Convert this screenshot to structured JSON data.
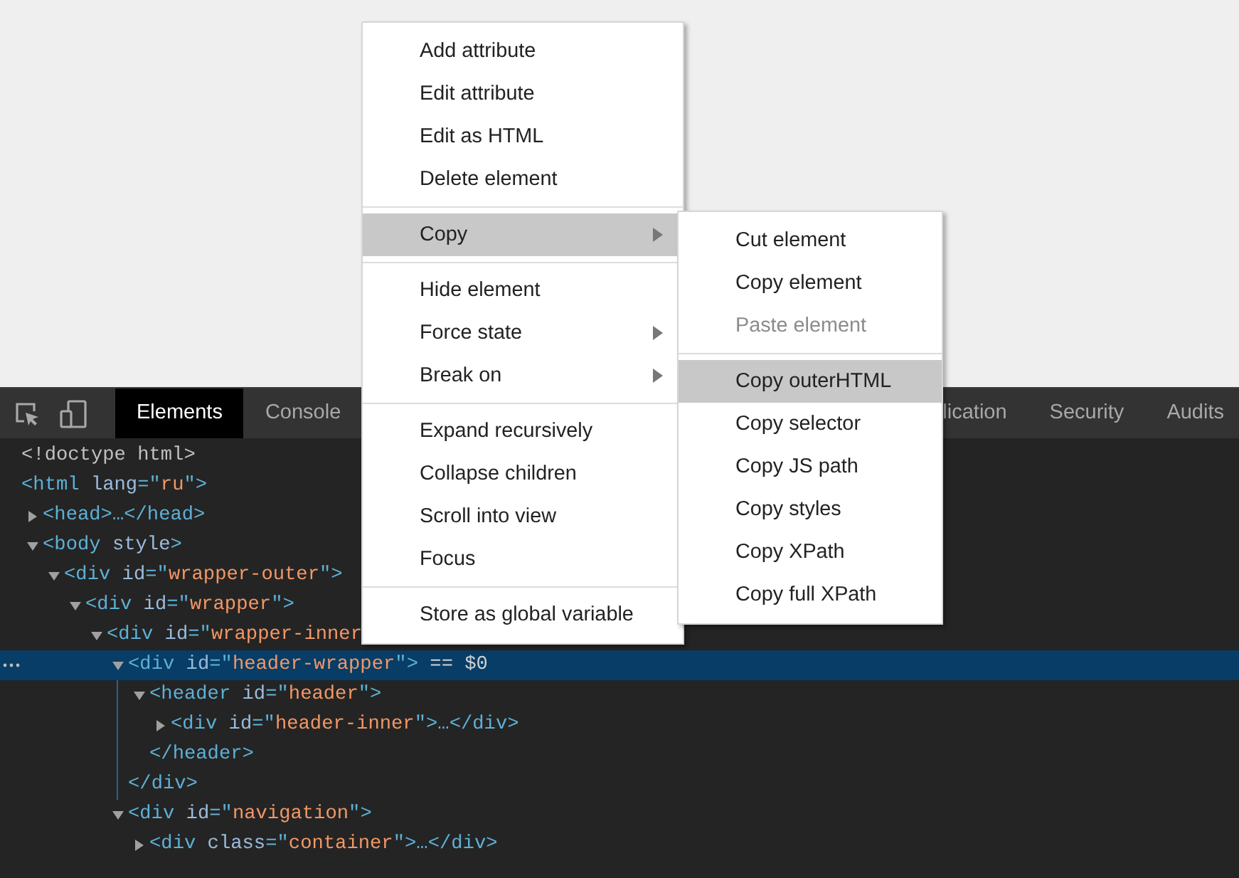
{
  "toolbar": {
    "tabs": [
      {
        "label": "Elements",
        "selected": true
      },
      {
        "label": "Console",
        "selected": false
      },
      {
        "label": "lication",
        "selected": false
      },
      {
        "label": "Security",
        "selected": false
      },
      {
        "label": "Audits",
        "selected": false
      }
    ]
  },
  "dom_tree": [
    {
      "parts": [
        {
          "kind": "doctype",
          "text": "<!doctype html>"
        }
      ]
    },
    {
      "parts": [
        {
          "kind": "tag",
          "text": "<html "
        },
        {
          "kind": "attr",
          "text": "lang"
        },
        {
          "kind": "tag",
          "text": "=\""
        },
        {
          "kind": "value",
          "text": "ru"
        },
        {
          "kind": "tag",
          "text": "\">"
        }
      ],
      "children": [
        {
          "expanded": false,
          "parts": [
            {
              "kind": "tag",
              "text": "<head>…</head>"
            }
          ]
        },
        {
          "expanded": true,
          "parts": [
            {
              "kind": "tag",
              "text": "<body "
            },
            {
              "kind": "attr",
              "text": "style"
            },
            {
              "kind": "tag",
              "text": ">"
            }
          ],
          "children": [
            {
              "expanded": true,
              "parts": [
                {
                  "kind": "tag",
                  "text": "<div "
                },
                {
                  "kind": "attr",
                  "text": "id"
                },
                {
                  "kind": "tag",
                  "text": "=\""
                },
                {
                  "kind": "value",
                  "text": "wrapper-outer"
                },
                {
                  "kind": "tag",
                  "text": "\">"
                }
              ],
              "children": [
                {
                  "expanded": true,
                  "parts": [
                    {
                      "kind": "tag",
                      "text": "<div "
                    },
                    {
                      "kind": "attr",
                      "text": "id"
                    },
                    {
                      "kind": "tag",
                      "text": "=\""
                    },
                    {
                      "kind": "value",
                      "text": "wrapper"
                    },
                    {
                      "kind": "tag",
                      "text": "\">"
                    }
                  ],
                  "children": [
                    {
                      "expanded": true,
                      "parts": [
                        {
                          "kind": "tag",
                          "text": "<div "
                        },
                        {
                          "kind": "attr",
                          "text": "id"
                        },
                        {
                          "kind": "tag",
                          "text": "=\""
                        },
                        {
                          "kind": "value",
                          "text": "wrapper-inner"
                        }
                      ],
                      "children": [
                        {
                          "expanded": true,
                          "selected": true,
                          "parts": [
                            {
                              "kind": "tag",
                              "text": "<div "
                            },
                            {
                              "kind": "attr",
                              "text": "id"
                            },
                            {
                              "kind": "tag",
                              "text": "=\""
                            },
                            {
                              "kind": "value",
                              "text": "header-wrapper"
                            },
                            {
                              "kind": "tag",
                              "text": "\">"
                            },
                            {
                              "kind": "text",
                              "text": " == $0"
                            }
                          ],
                          "children": [
                            {
                              "expanded": true,
                              "parts": [
                                {
                                  "kind": "tag",
                                  "text": "<header "
                                },
                                {
                                  "kind": "attr",
                                  "text": "id"
                                },
                                {
                                  "kind": "tag",
                                  "text": "=\""
                                },
                                {
                                  "kind": "value",
                                  "text": "header"
                                },
                                {
                                  "kind": "tag",
                                  "text": "\">"
                                }
                              ],
                              "children": [
                                {
                                  "expanded": false,
                                  "parts": [
                                    {
                                      "kind": "tag",
                                      "text": "<div "
                                    },
                                    {
                                      "kind": "attr",
                                      "text": "id"
                                    },
                                    {
                                      "kind": "tag",
                                      "text": "=\""
                                    },
                                    {
                                      "kind": "value",
                                      "text": "header-inner"
                                    },
                                    {
                                      "kind": "tag",
                                      "text": "\">…</div>"
                                    }
                                  ]
                                }
                              ],
                              "closing": "</header>"
                            }
                          ],
                          "closing": "</div>"
                        },
                        {
                          "expanded": true,
                          "parts": [
                            {
                              "kind": "tag",
                              "text": "<div "
                            },
                            {
                              "kind": "attr",
                              "text": "id"
                            },
                            {
                              "kind": "tag",
                              "text": "=\""
                            },
                            {
                              "kind": "value",
                              "text": "navigation"
                            },
                            {
                              "kind": "tag",
                              "text": "\">"
                            }
                          ],
                          "children": [
                            {
                              "expanded": false,
                              "parts": [
                                {
                                  "kind": "tag",
                                  "text": "<div "
                                },
                                {
                                  "kind": "attr",
                                  "text": "class"
                                },
                                {
                                  "kind": "tag",
                                  "text": "=\""
                                },
                                {
                                  "kind": "value",
                                  "text": "container"
                                },
                                {
                                  "kind": "tag",
                                  "text": "\">…</div>"
                                }
                              ]
                            }
                          ]
                        }
                      ]
                    }
                  ]
                }
              ]
            }
          ]
        }
      ]
    }
  ],
  "context_menu": [
    {
      "kind": "item",
      "label": "Add attribute"
    },
    {
      "kind": "item",
      "label": "Edit attribute"
    },
    {
      "kind": "item",
      "label": "Edit as HTML"
    },
    {
      "kind": "item",
      "label": "Delete element"
    },
    {
      "kind": "separator"
    },
    {
      "kind": "submenu",
      "label": "Copy",
      "selected": true
    },
    {
      "kind": "separator"
    },
    {
      "kind": "item",
      "label": "Hide element"
    },
    {
      "kind": "submenu",
      "label": "Force state",
      "selected": false
    },
    {
      "kind": "submenu",
      "label": "Break on",
      "selected": false
    },
    {
      "kind": "separator"
    },
    {
      "kind": "item",
      "label": "Expand recursively"
    },
    {
      "kind": "item",
      "label": "Collapse children"
    },
    {
      "kind": "item",
      "label": "Scroll into view"
    },
    {
      "kind": "item",
      "label": "Focus"
    },
    {
      "kind": "separator"
    },
    {
      "kind": "item",
      "label": "Store as global variable"
    }
  ],
  "copy_submenu": [
    {
      "kind": "item",
      "label": "Cut element",
      "selected": false,
      "disabled": false
    },
    {
      "kind": "item",
      "label": "Copy element",
      "selected": false,
      "disabled": false
    },
    {
      "kind": "item",
      "label": "Paste element",
      "selected": false,
      "disabled": true
    },
    {
      "kind": "separator"
    },
    {
      "kind": "item",
      "label": "Copy outerHTML",
      "selected": true,
      "disabled": false
    },
    {
      "kind": "item",
      "label": "Copy selector",
      "selected": false,
      "disabled": false
    },
    {
      "kind": "item",
      "label": "Copy JS path",
      "selected": false,
      "disabled": false
    },
    {
      "kind": "item",
      "label": "Copy styles",
      "selected": false,
      "disabled": false
    },
    {
      "kind": "item",
      "label": "Copy XPath",
      "selected": false,
      "disabled": false
    },
    {
      "kind": "item",
      "label": "Copy full XPath",
      "selected": false,
      "disabled": false
    }
  ]
}
